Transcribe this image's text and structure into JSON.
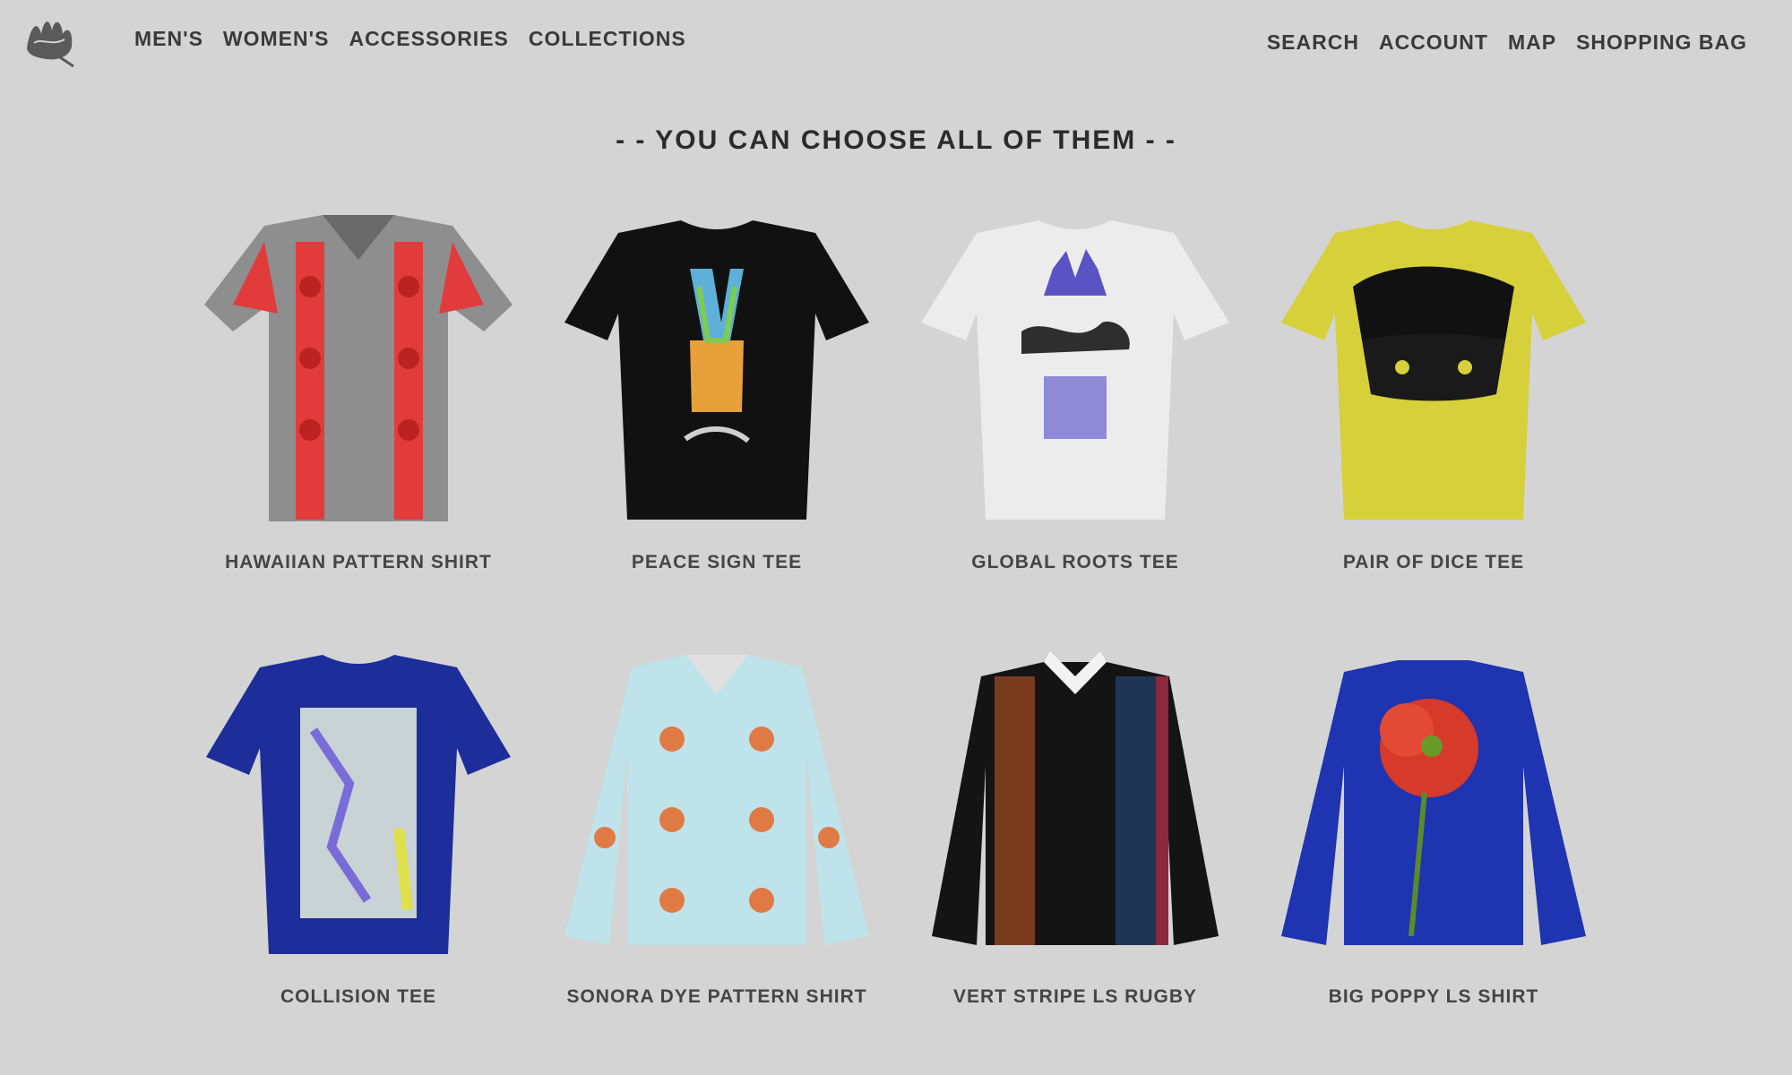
{
  "header": {
    "logo_alt": "Stüssy",
    "nav_left": [
      "MEN'S",
      "WOMEN'S",
      "ACCESSORIES",
      "COLLECTIONS"
    ],
    "nav_right": [
      "SEARCH",
      "ACCOUNT",
      "MAP",
      "SHOPPING BAG"
    ]
  },
  "headline": "- - YOU CAN CHOOSE ALL OF THEM - -",
  "products": [
    {
      "name": "HAWAIIAN PATTERN SHIRT",
      "icon": "hawaiian-shirt-icon",
      "colors": {
        "base": "#8e8e8e",
        "accent": "#e23b3b"
      }
    },
    {
      "name": "PEACE SIGN TEE",
      "icon": "peace-sign-tee-icon",
      "colors": {
        "base": "#111111",
        "accent": "#e8a03a"
      }
    },
    {
      "name": "GLOBAL ROOTS TEE",
      "icon": "global-roots-tee-icon",
      "colors": {
        "base": "#ececec",
        "accent": "#5a53c4"
      }
    },
    {
      "name": "PAIR OF DICE TEE",
      "icon": "dice-tee-icon",
      "colors": {
        "base": "#d6d03a",
        "accent": "#111111"
      }
    },
    {
      "name": "COLLISION TEE",
      "icon": "collision-tee-icon",
      "colors": {
        "base": "#1d2d9a",
        "accent": "#c9d3d6"
      }
    },
    {
      "name": "SONORA DYE PATTERN SHIRT",
      "icon": "sonora-shirt-icon",
      "colors": {
        "base": "#bfe3ea",
        "accent": "#e07a45"
      }
    },
    {
      "name": "VERT STRIPE LS RUGBY",
      "icon": "rugby-shirt-icon",
      "colors": {
        "base": "#141414",
        "accent": "#7a3a1e"
      }
    },
    {
      "name": "BIG POPPY LS SHIRT",
      "icon": "poppy-shirt-icon",
      "colors": {
        "base": "#1e34b0",
        "accent": "#d63a2a"
      }
    }
  ]
}
